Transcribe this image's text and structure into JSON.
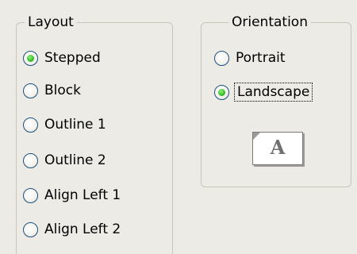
{
  "layout": {
    "legend": "Layout",
    "options": [
      {
        "label": "Stepped",
        "selected": true
      },
      {
        "label": "Block",
        "selected": false
      },
      {
        "label": "Outline 1",
        "selected": false
      },
      {
        "label": "Outline 2",
        "selected": false
      },
      {
        "label": "Align Left 1",
        "selected": false
      },
      {
        "label": "Align Left 2",
        "selected": false
      }
    ]
  },
  "orientation": {
    "legend": "Orientation",
    "options": [
      {
        "label": "Portrait",
        "selected": false
      },
      {
        "label": "Landscape",
        "selected": true
      }
    ],
    "preview_letter": "A"
  },
  "colors": {
    "background": "#ecebe5",
    "radio_border": "#1c5180",
    "radio_dot": "#3ec22a",
    "groupbox_border": "#c8c6b8"
  }
}
